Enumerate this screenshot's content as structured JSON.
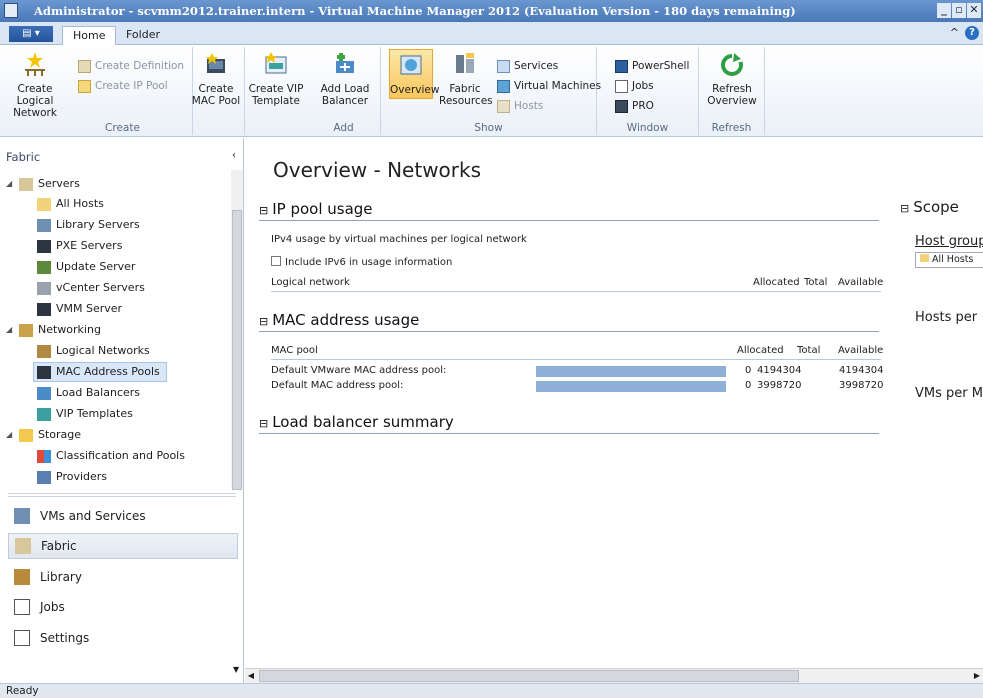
{
  "window": {
    "title": "Administrator - scvmm2012.trainer.intern - Virtual Machine Manager 2012 (Evaluation Version - 180 days remaining)"
  },
  "tabs": {
    "home": "Home",
    "folder": "Folder"
  },
  "ribbon": {
    "create": {
      "label": "Create",
      "create_logical_network": "Create Logical Network",
      "create_definition": "Create Definition",
      "create_ip_pool": "Create IP Pool",
      "create_mac_pool": "Create MAC Pool",
      "create_vip_template": "Create VIP Template"
    },
    "add": {
      "label": "Add",
      "add_load_balancer": "Add Load Balancer"
    },
    "show": {
      "label": "Show",
      "overview": "Overview",
      "fabric_resources": "Fabric Resources",
      "services": "Services",
      "virtual_machines": "Virtual Machines",
      "hosts": "Hosts"
    },
    "window": {
      "label": "Window",
      "powershell": "PowerShell",
      "jobs": "Jobs",
      "pro": "PRO"
    },
    "refresh": {
      "label": "Refresh",
      "refresh_overview": "Refresh Overview"
    }
  },
  "nav": {
    "header": "Fabric",
    "tree": {
      "servers": "Servers",
      "all_hosts": "All Hosts",
      "library_servers": "Library Servers",
      "pxe_servers": "PXE Servers",
      "update_server": "Update Server",
      "vcenter_servers": "vCenter Servers",
      "vmm_server": "VMM Server",
      "networking": "Networking",
      "logical_networks": "Logical Networks",
      "mac_address_pools": "MAC Address Pools",
      "load_balancers": "Load Balancers",
      "vip_templates": "VIP Templates",
      "storage": "Storage",
      "classification_and_pools": "Classification and Pools",
      "providers": "Providers"
    },
    "workspaces": {
      "vms_and_services": "VMs and Services",
      "fabric": "Fabric",
      "library": "Library",
      "jobs": "Jobs",
      "settings": "Settings"
    }
  },
  "main": {
    "title": "Overview - Networks",
    "ip_pool": {
      "heading": "IP pool usage",
      "description": "IPv4 usage by virtual machines per logical network",
      "include_ipv6": "Include IPv6 in usage information",
      "col_logical_network": "Logical network",
      "col_allocated": "Allocated",
      "col_total": "Total",
      "col_available": "Available"
    },
    "mac": {
      "heading": "MAC address usage",
      "col_mac_pool": "MAC pool",
      "col_allocated": "Allocated",
      "col_total": "Total",
      "col_available": "Available",
      "rows": [
        {
          "name": "Default VMware MAC address pool:",
          "allocated": "0",
          "total": "4194304",
          "available": "4194304"
        },
        {
          "name": "Default MAC address pool:",
          "allocated": "0",
          "total": "3998720",
          "available": "3998720"
        }
      ]
    },
    "load_balancer": {
      "heading": "Load balancer summary"
    },
    "scope": {
      "heading": "Scope",
      "host_group": "Host group",
      "host_group_value": "All Hosts",
      "hosts_per": "Hosts per",
      "vms_per": "VMs per M"
    }
  },
  "status": {
    "text": "Ready"
  }
}
